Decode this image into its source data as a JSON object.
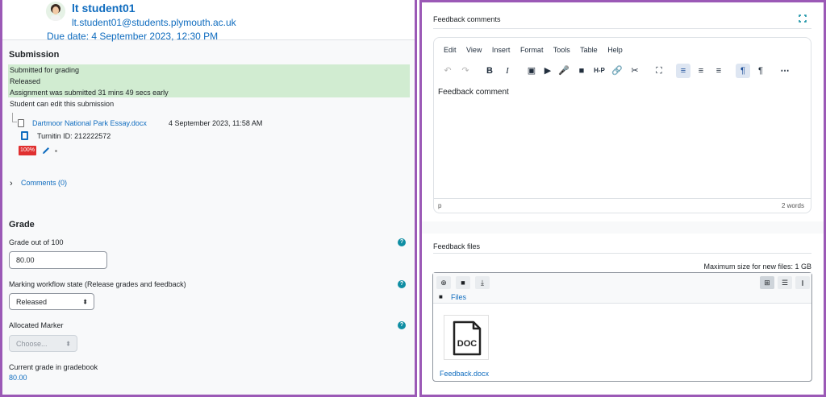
{
  "student": {
    "name": "lt student01",
    "email": "lt.student01@students.plymouth.ac.uk",
    "due_date": "Due date: 4 September 2023, 12:30 PM"
  },
  "submission": {
    "title": "Submission",
    "status_lines": [
      "Submitted for grading",
      "Released",
      "Assignment was submitted 31 mins 49 secs early"
    ],
    "edit_note": "Student can edit this submission",
    "file_name": "Dartmoor National Park Essay.docx",
    "file_date": "4 September 2023, 11:58 AM",
    "turnitin_id": "Turnitin ID: 212222572",
    "similarity": "100%",
    "similarity_color": "#e03030",
    "comments_link": "Comments (0)"
  },
  "grade": {
    "title": "Grade",
    "grade_label": "Grade out of 100",
    "grade_value": "80.00",
    "workflow_label": "Marking workflow state (Release grades and feedback)",
    "workflow_value": "Released",
    "marker_label": "Allocated Marker",
    "marker_value": "Choose...",
    "current_label": "Current grade in gradebook",
    "current_value": "80.00"
  },
  "feedback": {
    "comments_label": "Feedback comments",
    "menu": [
      "Edit",
      "View",
      "Insert",
      "Format",
      "Tools",
      "Table",
      "Help"
    ],
    "body_text": "Feedback comment",
    "path_tag": "p",
    "word_count": "2 words",
    "files_label": "Feedback files",
    "max_size": "Maximum size for new files: 1 GB",
    "folder_name": "Files",
    "doc_badge": "DOC",
    "doc_file": "Feedback.docx"
  },
  "colors": {
    "accent": "#0f6cbf",
    "frame": "#9b59b6",
    "status_bg": "#d1ecd1",
    "help_icon": "#0f8ea3"
  }
}
